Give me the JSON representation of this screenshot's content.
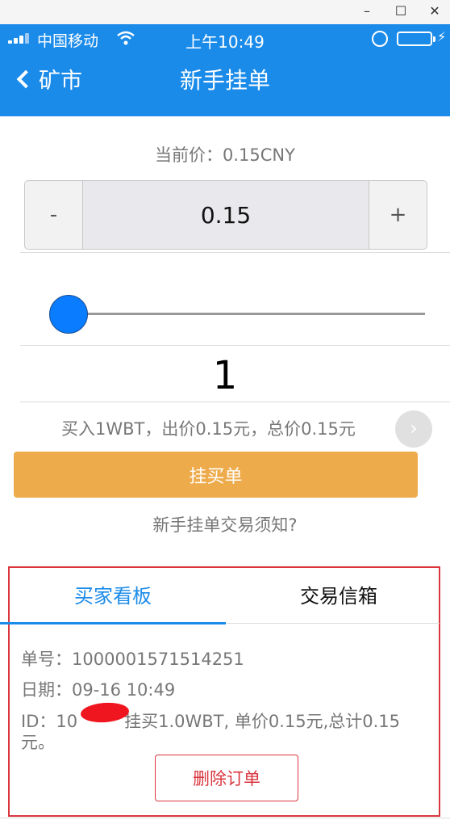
{
  "window": {
    "minimize": "–",
    "maximize": "☐",
    "close": "✕"
  },
  "status_bar": {
    "carrier": "中国移动",
    "time": "上午10:49",
    "battery_level": 1.0,
    "colors": {
      "battery": "#4cd964"
    }
  },
  "nav": {
    "back_label": "矿市",
    "title": "新手挂单",
    "background": "#1b8bea"
  },
  "order_form": {
    "current_price": "当前价：0.15CNY",
    "minus_label": "-",
    "plus_label": "+",
    "price_value": "0.15",
    "slider_level": 0.0,
    "quantity": "1",
    "summary": "买入1WBT，出价0.15元，总价0.15元",
    "next_icon": "›",
    "submit_label": "挂买单",
    "submit_color": "#eeab4b",
    "notice_link": "新手挂单交易须知?"
  },
  "panel": {
    "tabs": [
      {
        "label": "买家看板",
        "active": true
      },
      {
        "label": "交易信箱",
        "active": false
      }
    ],
    "order": {
      "number": "单号：1000001571514251",
      "date": "日期：09-16 10:49",
      "id_prefix": "ID：10",
      "id_rest": "挂买1.0WBT, 单价0.15元,总计0.15",
      "id_wrap": "元。"
    },
    "delete_label": "删除订单",
    "accent_color": "#d9363e"
  }
}
